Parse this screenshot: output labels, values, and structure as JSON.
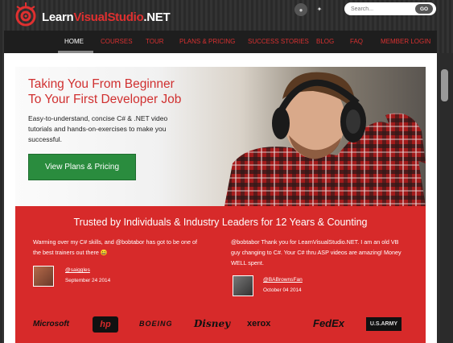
{
  "header": {
    "logo_learn": "Learn",
    "logo_vs": "VisualStudio",
    "logo_net": ".NET"
  },
  "search": {
    "placeholder": "Search...",
    "button": "GO"
  },
  "nav": {
    "items": [
      {
        "label": "HOME"
      },
      {
        "label": "COURSES"
      },
      {
        "label": "TOUR"
      },
      {
        "label": "PLANS & PRICING"
      },
      {
        "label": "SUCCESS STORIES"
      },
      {
        "label": "BLOG"
      },
      {
        "label": "FAQ"
      },
      {
        "label": "MEMBER LOGIN"
      }
    ]
  },
  "hero": {
    "title_line1": "Taking You From Beginner",
    "title_line2": "To Your First Developer Job",
    "subtitle": "Easy-to-understand, concise C# & .NET video tutorials and hands-on-exercises to make you successful.",
    "cta": "View Plans & Pricing"
  },
  "trusted": {
    "title": "Trusted by Individuals & Industry Leaders for 12 Years & Counting",
    "tweets": [
      {
        "text": "Warming over my C# skills, and @bobtabor has got to be one of the best trainers out there 😀",
        "handle": "@saiggles",
        "date": "September 24 2014"
      },
      {
        "text": "@bobtabor Thank you for LearnVisualStudio.NET. I am an old VB guy changing to C#. Your C# thru ASP videos are amazing! Money WELL spent.",
        "handle": "@BABrownsFan",
        "date": "October 04 2014"
      }
    ],
    "brands": [
      "Microsoft",
      "hp",
      "BOEING",
      "Disney",
      "xerox",
      "FedEx",
      "U.S.ARMY"
    ]
  },
  "colors": {
    "accent_red": "#d72a2a",
    "cta_green": "#2a8c3e",
    "nav_bg": "#1e1e1e"
  }
}
